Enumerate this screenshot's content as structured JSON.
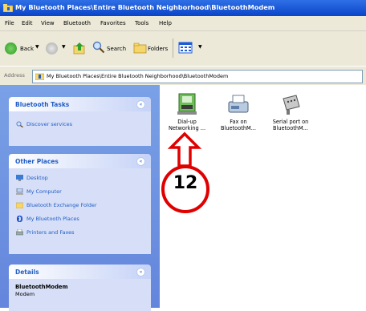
{
  "window": {
    "title": "My Bluetooth Places\\Entire Bluetooth Neighborhood\\BluetoothModem"
  },
  "menu": [
    "File",
    "Edit",
    "View",
    "Bluetooth",
    "Favorites",
    "Tools",
    "Help"
  ],
  "toolbar": {
    "back_label": "Back",
    "search_label": "Search",
    "folders_label": "Folders"
  },
  "address": {
    "label": "Address",
    "value": "My Bluetooth Places\\Entire Bluetooth Neighborhood\\BluetoothModem"
  },
  "sidebar": {
    "bluetooth_tasks": {
      "title": "Bluetooth Tasks",
      "items": [
        "Discover services"
      ]
    },
    "other_places": {
      "title": "Other Places",
      "items": [
        "Desktop",
        "My Computer",
        "Bluetooth Exchange Folder",
        "My Bluetooth Places",
        "Printers and Faxes"
      ]
    },
    "details": {
      "title": "Details",
      "name": "BluetoothModem",
      "type": "Modem"
    }
  },
  "files": [
    {
      "line1": "Dial-up",
      "line2": "Networking ...",
      "icon": "dialup-networking-icon"
    },
    {
      "line1": "Fax on",
      "line2": "BluetoothM...",
      "icon": "fax-icon"
    },
    {
      "line1": "Serial port on",
      "line2": "BluetoothM...",
      "icon": "serial-port-icon"
    }
  ],
  "callout": {
    "number": "12"
  }
}
